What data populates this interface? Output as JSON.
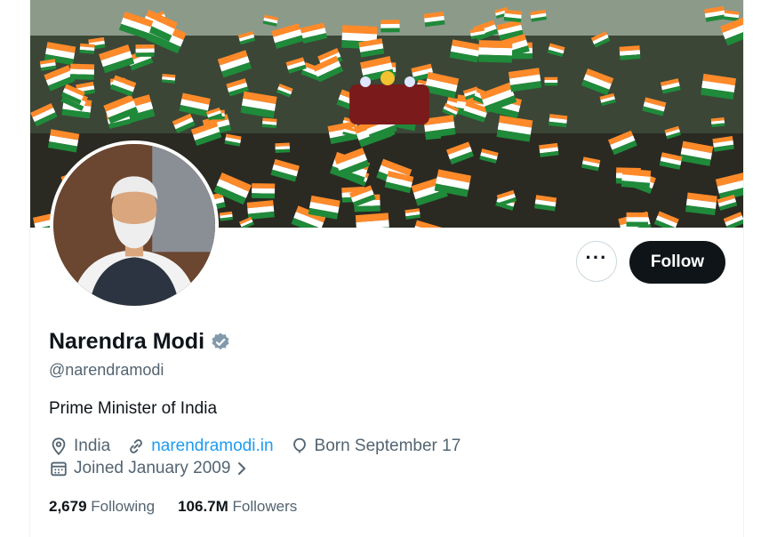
{
  "profile": {
    "name": "Narendra Modi",
    "handle": "@narendramodi",
    "bio": "Prime Minister of India",
    "location": "India",
    "website": "narendramodi.in",
    "born": "Born September 17",
    "joined": "Joined January 2009",
    "following_count": "2,679",
    "following_label": "Following",
    "followers_count": "106.7M",
    "followers_label": "Followers"
  },
  "actions": {
    "more_label": "···",
    "follow_label": "Follow"
  },
  "colors": {
    "accent": "#1d9bf0",
    "text": "#0f1419",
    "secondary": "#536471",
    "verified": "#829aab"
  },
  "icons": {
    "verified": "verified-badge-icon",
    "location": "location-pin-icon",
    "website": "link-icon",
    "born": "balloon-icon",
    "joined": "calendar-icon"
  }
}
